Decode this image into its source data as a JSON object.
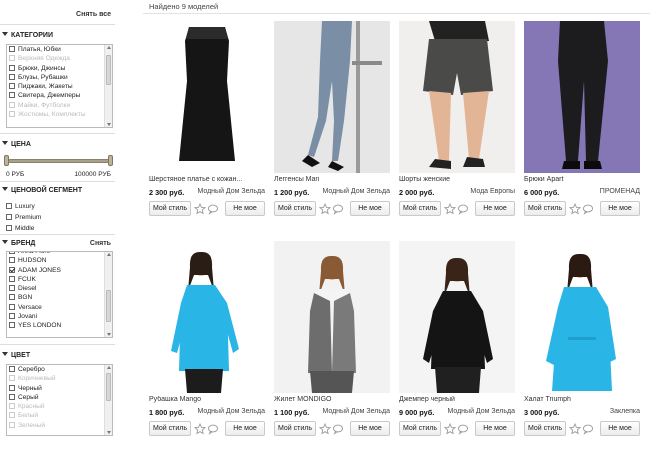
{
  "sidebar": {
    "clear_all": "Снять все",
    "categories": {
      "title": "КАТЕГОРИИ",
      "items": [
        {
          "label": "Платья, Юбки",
          "checked": false,
          "disabled": false
        },
        {
          "label": "Верхняя Одежда",
          "checked": false,
          "disabled": true
        },
        {
          "label": "Брюки, Джинсы",
          "checked": false,
          "disabled": false
        },
        {
          "label": "Блузы, Рубашки",
          "checked": false,
          "disabled": false
        },
        {
          "label": "Пиджаки, Жакеты",
          "checked": false,
          "disabled": false
        },
        {
          "label": "Свитера, Джемперы",
          "checked": false,
          "disabled": false
        },
        {
          "label": "Майки, Футболки",
          "checked": false,
          "disabled": true
        },
        {
          "label": "Жостюмы, Комплекты",
          "checked": false,
          "disabled": true
        }
      ]
    },
    "price": {
      "title": "ЦЕНА",
      "min_label": "0 РУБ",
      "max_label": "100000 РУБ",
      "range_selected": [
        0,
        1
      ]
    },
    "segment": {
      "title": "ЦЕНОВОЙ СЕГМЕНТ",
      "items": [
        {
          "label": "Luxury",
          "checked": false
        },
        {
          "label": "Premium",
          "checked": false
        },
        {
          "label": "Middle",
          "checked": false
        }
      ]
    },
    "brand": {
      "title": "БРЕНД",
      "action": "Снять",
      "items": [
        {
          "label": "Anna Fiore",
          "checked": false,
          "disabled": false
        },
        {
          "label": "HUDSON",
          "checked": false,
          "disabled": false
        },
        {
          "label": "ADAM JONES",
          "checked": true,
          "disabled": false
        },
        {
          "label": "FCUK",
          "checked": false,
          "disabled": false
        },
        {
          "label": "Diesel",
          "checked": false,
          "disabled": false
        },
        {
          "label": "BGN",
          "checked": false,
          "disabled": false
        },
        {
          "label": "Versace",
          "checked": false,
          "disabled": false
        },
        {
          "label": "Jovani",
          "checked": false,
          "disabled": false
        },
        {
          "label": "YES LONDON",
          "checked": false,
          "disabled": false
        }
      ]
    },
    "color": {
      "title": "ЦВЕТ",
      "items": [
        {
          "label": "Серебро",
          "checked": false,
          "disabled": false
        },
        {
          "label": "Коричневый",
          "checked": false,
          "disabled": true
        },
        {
          "label": "Черный",
          "checked": false,
          "disabled": false
        },
        {
          "label": "Серый",
          "checked": false,
          "disabled": false
        },
        {
          "label": "Красный",
          "checked": false,
          "disabled": true
        },
        {
          "label": "Белый",
          "checked": false,
          "disabled": true
        },
        {
          "label": "Зеленый",
          "checked": false,
          "disabled": true
        }
      ]
    }
  },
  "main": {
    "found_text": "Найдено 9 моделей",
    "buttons": {
      "style": "Мой стиль",
      "not_mine": "Не мое"
    },
    "products": [
      {
        "name": "Шерстяное платье с кожан...",
        "price": "2 300 руб.",
        "store": "Модный Дом Зельда",
        "photo": "black-dress"
      },
      {
        "name": "Леггенсы Mari",
        "price": "1 200 руб.",
        "store": "Модный Дом Зельда",
        "photo": "leggings"
      },
      {
        "name": "Шорты женские",
        "price": "2 000 руб.",
        "store": "Мода Европы",
        "photo": "shorts"
      },
      {
        "name": "Брюки Apart",
        "price": "6 000 руб.",
        "store": "ПРОМЕНАД",
        "photo": "trousers"
      },
      {
        "name": "Рубашка Mango",
        "price": "1 800 руб.",
        "store": "Модный Дом Зельда",
        "photo": "blue-shirt"
      },
      {
        "name": "Жилет MONDIGO",
        "price": "1 100 руб.",
        "store": "Модный Дом Зельда",
        "photo": "gray-vest"
      },
      {
        "name": "Джемпер черный",
        "price": "9 000 руб.",
        "store": "Модный Дом Зельда",
        "photo": "black-jumper"
      },
      {
        "name": "Халат Triumph",
        "price": "3 000 руб.",
        "store": "Заклепка",
        "photo": "blue-robe"
      }
    ]
  },
  "colors": {
    "accent_blue": "#29b6e6",
    "slider": "#a8a08a",
    "divider": "#dddddd"
  }
}
